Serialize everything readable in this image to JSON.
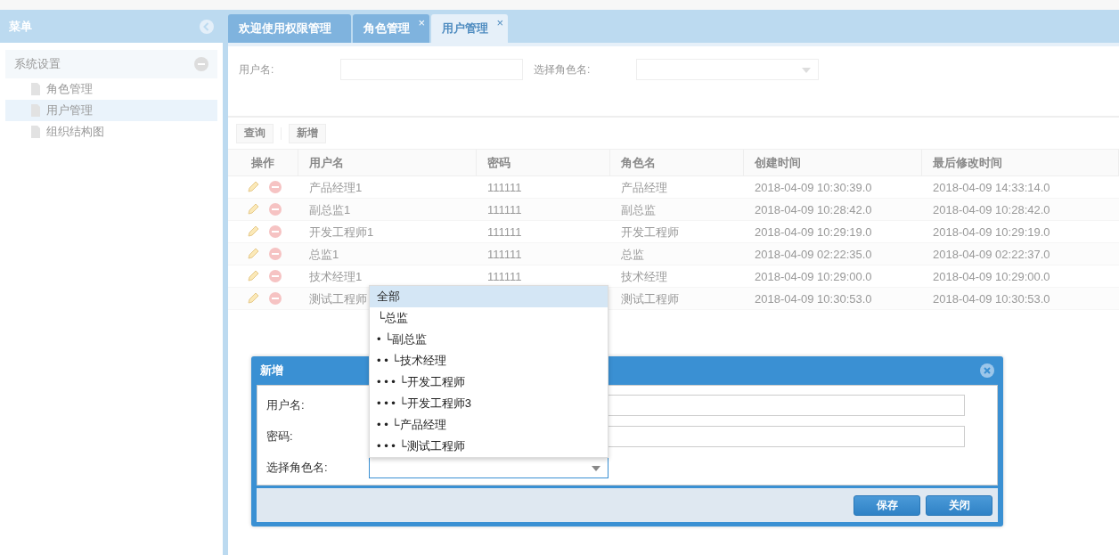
{
  "sidebar": {
    "title": "菜单",
    "group": {
      "label": "系统设置",
      "expanded": true,
      "children": [
        {
          "label": "角色管理",
          "selected": false
        },
        {
          "label": "用户管理",
          "selected": true
        },
        {
          "label": "组织结构图",
          "selected": false
        }
      ]
    }
  },
  "tabs": [
    {
      "label": "欢迎使用权限管理",
      "selected": false
    },
    {
      "label": "角色管理",
      "close": "×",
      "selected": false
    },
    {
      "label": "用户管理",
      "close": "×",
      "selected": true
    }
  ],
  "search": {
    "fields": [
      {
        "label": "用户名:",
        "kind": "text"
      },
      {
        "label": "选择角色名:",
        "kind": "select"
      }
    ]
  },
  "toolbar": [
    "查询",
    "新增"
  ],
  "table": {
    "columns": [
      "操作",
      "用户名",
      "密码",
      "角色名",
      "创建时间",
      "最后修改时间"
    ],
    "rows": [
      [
        "",
        "产品经理1",
        "111111",
        "产品经理",
        "2018-04-09 10:30:39.0",
        "2018-04-09 14:33:14.0"
      ],
      [
        "",
        "副总监1",
        "111111",
        "副总监",
        "2018-04-09 10:28:42.0",
        "2018-04-09 10:28:42.0"
      ],
      [
        "",
        "开发工程师1",
        "111111",
        "开发工程师",
        "2018-04-09 10:29:19.0",
        "2018-04-09 10:29:19.0"
      ],
      [
        "",
        "总监1",
        "111111",
        "总监",
        "2018-04-09 02:22:35.0",
        "2018-04-09 02:22:37.0"
      ],
      [
        "",
        "技术经理1",
        "111111",
        "技术经理",
        "2018-04-09 10:29:00.0",
        "2018-04-09 10:29:00.0"
      ],
      [
        "",
        "测试工程师",
        "",
        "测试工程师",
        "2018-04-09 10:30:53.0",
        "2018-04-09 10:30:53.0"
      ]
    ]
  },
  "dialog": {
    "title": "新增",
    "fields": [
      {
        "label": "用户名:",
        "kind": "text"
      },
      {
        "label": "密码:",
        "kind": "text"
      },
      {
        "label": "选择角色名:",
        "kind": "select"
      }
    ],
    "dropdown": [
      {
        "label": "全部",
        "selected": true
      },
      {
        "label": "└总监",
        "selected": false
      },
      {
        "label": "• └副总监",
        "selected": false
      },
      {
        "label": "• • └技术经理",
        "selected": false
      },
      {
        "label": "• • • └开发工程师",
        "selected": false
      },
      {
        "label": "• • • └开发工程师3",
        "selected": false
      },
      {
        "label": "• • └产品经理",
        "selected": false
      },
      {
        "label": "• • • └测试工程师",
        "selected": false
      }
    ],
    "buttons": [
      "保存",
      "关闭"
    ]
  }
}
